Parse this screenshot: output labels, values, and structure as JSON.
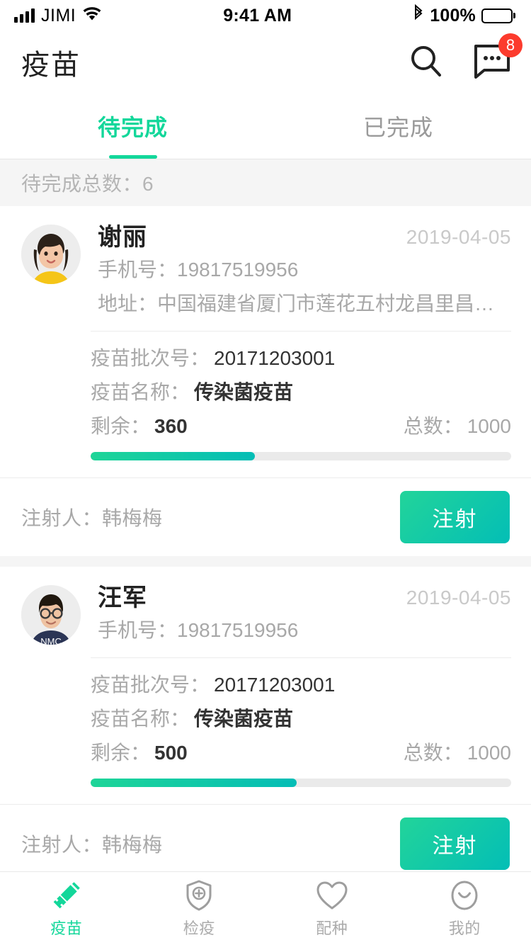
{
  "status_bar": {
    "carrier": "JIMI",
    "time": "9:41 AM",
    "battery_pct": "100%",
    "signal_icon": "signal-bars-icon",
    "wifi_icon": "wifi-icon",
    "bluetooth_icon": "bluetooth-icon",
    "battery_icon": "battery-full-icon"
  },
  "header": {
    "title": "疫苗",
    "search_icon": "search-icon",
    "message_icon": "message-bubble-icon",
    "message_badge": "8"
  },
  "tabs": [
    {
      "label": "待完成",
      "active": true
    },
    {
      "label": "已完成",
      "active": false
    }
  ],
  "summary": {
    "text": "待完成总数：6"
  },
  "colors": {
    "accent_green": "#13D79A",
    "accent_teal": "#03BEB6",
    "badge_red": "#FC3B2D",
    "text_gray": "#a8a8a8",
    "bg_gray": "#F5F5F5"
  },
  "labels": {
    "phone": "手机号：",
    "address": "地址：",
    "batch": "疫苗批次号：",
    "vaccine_name": "疫苗名称：",
    "remaining": "剩余：",
    "total": "总数：",
    "injector": "注射人：",
    "inject_button": "注射"
  },
  "cards": [
    {
      "name": "谢丽",
      "date": "2019-04-05",
      "phone": "19817519956",
      "address": "中国福建省厦门市莲花五村龙昌里昌里号…",
      "has_address": true,
      "batch": "20171203001",
      "vaccine_name": "传染菌疫苗",
      "remaining": "360",
      "total": "1000",
      "progress_pct": "39",
      "injector": "韩梅梅",
      "button": "注射",
      "avatar": "avatar-woman-yellow-top"
    },
    {
      "name": "汪军",
      "date": "2019-04-05",
      "phone": "19817519956",
      "address": "",
      "has_address": false,
      "batch": "20171203001",
      "vaccine_name": "传染菌疫苗",
      "remaining": "500",
      "total": "1000",
      "progress_pct": "49",
      "injector": "韩梅梅",
      "button": "注射",
      "avatar": "avatar-man-glasses"
    }
  ],
  "bottom_nav": [
    {
      "label": "疫苗",
      "icon": "syringe-icon",
      "active": true
    },
    {
      "label": "检疫",
      "icon": "shield-plus-icon",
      "active": false
    },
    {
      "label": "配种",
      "icon": "heart-icon",
      "active": false
    },
    {
      "label": "我的",
      "icon": "smiley-face-icon",
      "active": false
    }
  ]
}
